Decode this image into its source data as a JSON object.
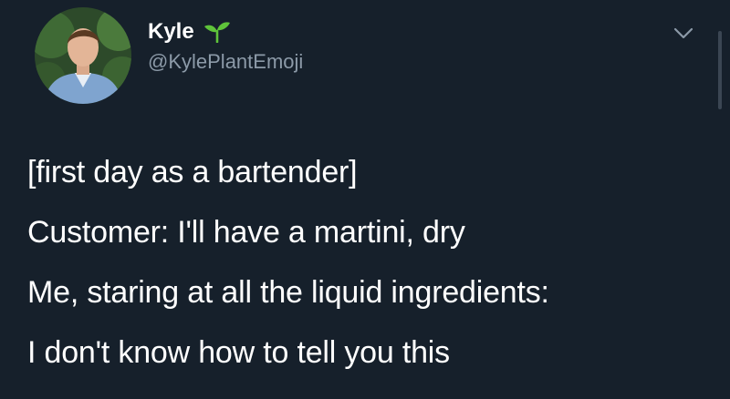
{
  "tweet": {
    "display_name": "Kyle",
    "handle": "@KylePlantEmoji",
    "lines": [
      "[first day as a bartender]",
      "Customer: I'll have a martini, dry",
      "Me, staring at all the liquid ingredients:",
      "I don't know how to tell you this"
    ]
  },
  "icons": {
    "name_badge": "seedling-icon",
    "menu": "chevron-down-icon"
  },
  "colors": {
    "background": "#16202b",
    "text": "#ffffff",
    "secondary_text": "#8c9aa8",
    "seedling": "#5fc43a"
  }
}
